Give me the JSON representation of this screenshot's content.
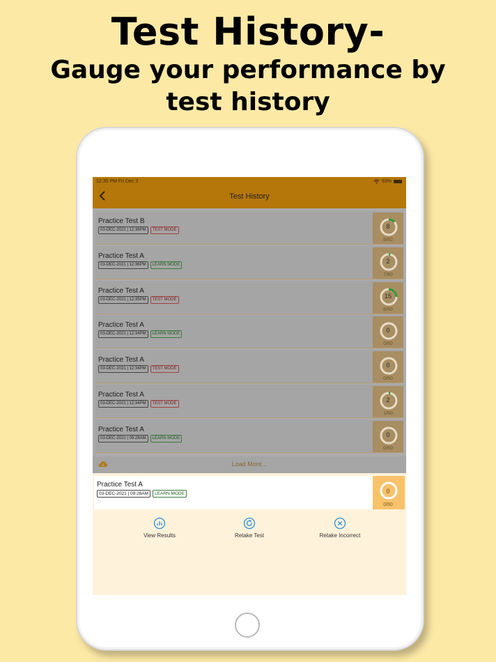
{
  "headline": {
    "title": "Test History-",
    "subtitle_line1": "Gauge your performance by",
    "subtitle_line2": "test history"
  },
  "status_bar": {
    "time": "12:35 PM   Fri Dec 3",
    "battery": "93%"
  },
  "nav": {
    "title": "Test History",
    "back_icon": "chevron-left-icon"
  },
  "rows": [
    {
      "name": "Practice Test B",
      "date": "03-DEC-2021 | 12:36PM",
      "mode": "TEST MODE",
      "score": "8",
      "total": "8/60",
      "progress": 0.133
    },
    {
      "name": "Practice Test A",
      "date": "03-DEC-2021 | 12:36PM",
      "mode": "LEARN MODE",
      "score": "2",
      "total": "7/60",
      "progress": 0.033
    },
    {
      "name": "Practice Test A",
      "date": "03-DEC-2021 | 12:35PM",
      "mode": "TEST MODE",
      "score": "15",
      "total": "8/60",
      "progress": 0.25
    },
    {
      "name": "Practice Test A",
      "date": "03-DEC-2021 | 12:34PM",
      "mode": "LEARN MODE",
      "score": "0",
      "total": "0/60",
      "progress": 0
    },
    {
      "name": "Practice Test A",
      "date": "03-DEC-2021 | 12:34PM",
      "mode": "TEST MODE",
      "score": "0",
      "total": "0/60",
      "progress": 0
    },
    {
      "name": "Practice Test A",
      "date": "03-DEC-2021 | 12:34PM",
      "mode": "TEST MODE",
      "score": "2",
      "total": "1/60",
      "progress": 0.033
    },
    {
      "name": "Practice Test A",
      "date": "03-DEC-2021 | 09:28AM",
      "mode": "LEARN MODE",
      "score": "0",
      "total": "0/60",
      "progress": 0
    }
  ],
  "load_more": {
    "label": "Load More...",
    "icon": "cloud-download-icon"
  },
  "selected_row": {
    "name": "Practice Test A",
    "date": "03-DEC-2021 | 09:28AM",
    "mode": "LEARN MODE",
    "score": "0",
    "total": "0/60",
    "progress": 0
  },
  "actions": {
    "view_results": "View Results",
    "retake_test": "Retake Test",
    "retake_incorrect": "Retake Incorrect"
  },
  "colors": {
    "background": "#fde9a6",
    "nav_brown": "#b5770a",
    "progress_green": "#2e9a3a",
    "action_blue": "#2a8fd8"
  }
}
